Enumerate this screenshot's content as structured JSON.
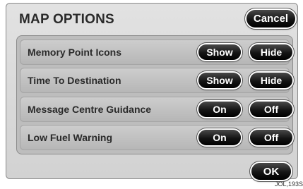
{
  "title": "MAP OPTIONS",
  "cancel_label": "Cancel",
  "ok_label": "OK",
  "rows": [
    {
      "label": "Memory Point Icons",
      "option1": "Show",
      "option2": "Hide"
    },
    {
      "label": "Time To Destination",
      "option1": "Show",
      "option2": "Hide"
    },
    {
      "label": "Message Centre Guidance",
      "option1": "On",
      "option2": "Off"
    },
    {
      "label": "Low Fuel Warning",
      "option1": "On",
      "option2": "Off"
    }
  ],
  "reference": "JOL,193S"
}
